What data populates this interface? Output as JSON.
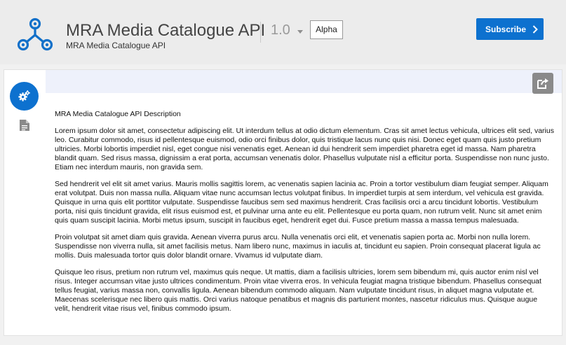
{
  "header": {
    "title": "MRA Media Catalogue API",
    "subtitle": "MRA Media Catalogue API",
    "version": "1.0",
    "badge": "Alpha",
    "subscribe_label": "Subscribe"
  },
  "sidebar": {
    "items": [
      {
        "icon": "gears-icon",
        "active": true
      },
      {
        "icon": "document-icon",
        "active": false
      }
    ]
  },
  "toolbar": {
    "export_icon": "share-icon"
  },
  "description": {
    "heading": "MRA Media Catalogue API Description",
    "paragraphs": [
      "Lorem ipsum dolor sit amet, consectetur adipiscing elit. Ut interdum tellus at odio dictum elementum. Cras sit amet lectus vehicula, ultrices elit sed, varius leo. Curabitur commodo, risus id pellentesque euismod, odio orci finibus dolor, quis tristique lacus nunc quis nisi. Donec eget quam quis justo pretium ultricies. Morbi lobortis imperdiet nisl, eget congue nisi venenatis eget. Aenean id dui hendrerit sem imperdiet pharetra eget id massa. Nam pharetra blandit quam. Sed risus massa, dignissim a erat porta, accumsan venenatis dolor. Phasellus vulputate nisl a efficitur porta. Suspendisse non nunc justo. Etiam nec interdum mauris, non gravida sem.",
      "Sed hendrerit vel elit sit amet varius. Mauris mollis sagittis lorem, ac venenatis sapien lacinia ac. Proin a tortor vestibulum diam feugiat semper. Aliquam erat volutpat. Duis non massa nulla. Aliquam vitae nunc accumsan lectus volutpat finibus. In imperdiet turpis at sem interdum, vel vehicula est gravida. Quisque in urna quis elit porttitor vulputate. Suspendisse faucibus sem sed maximus hendrerit. Cras facilisis orci a arcu tincidunt lobortis. Vestibulum porta, nisi quis tincidunt gravida, elit risus euismod est, et pulvinar urna ante eu elit. Pellentesque eu porta quam, non rutrum velit. Nunc sit amet enim quis quam suscipit lacinia. Morbi metus ipsum, suscipit in faucibus eget, hendrerit eget dui. Fusce pretium massa a massa tempus malesuada.",
      "Proin volutpat sit amet diam quis gravida. Aenean viverra purus arcu. Nulla venenatis orci elit, et venenatis sapien porta ac. Morbi non nulla lorem. Suspendisse non viverra nulla, sit amet facilisis metus. Nam libero nunc, maximus in iaculis at, tincidunt eu sapien. Proin consequat placerat ligula ac mollis. Duis malesuada tortor quis dolor blandit ornare. Vivamus id vulputate diam.",
      "Quisque leo risus, pretium non rutrum vel, maximus quis neque. Ut mattis, diam a facilisis ultricies, lorem sem bibendum mi, quis auctor enim nisl vel risus. Integer accumsan vitae justo ultrices condimentum. Proin vitae viverra eros. In vehicula feugiat magna tristique bibendum. Phasellus consequat tellus feugiat, varius massa non, convallis ligula. Aenean bibendum commodo aliquam. Nam vulputate tincidunt risus, in aliquet magna vulputate et. Maecenas scelerisque nec libero quis mattis. Orci varius natoque penatibus et magnis dis parturient montes, nascetur ridiculus mus. Quisque augue velit, hendrerit vitae risus vel, finibus commodo ipsum."
    ]
  },
  "colors": {
    "accent": "#0d71cf",
    "header_bg": "#ececec",
    "banner_bg": "#eef1fb",
    "export_bg": "#8a8a8a"
  }
}
